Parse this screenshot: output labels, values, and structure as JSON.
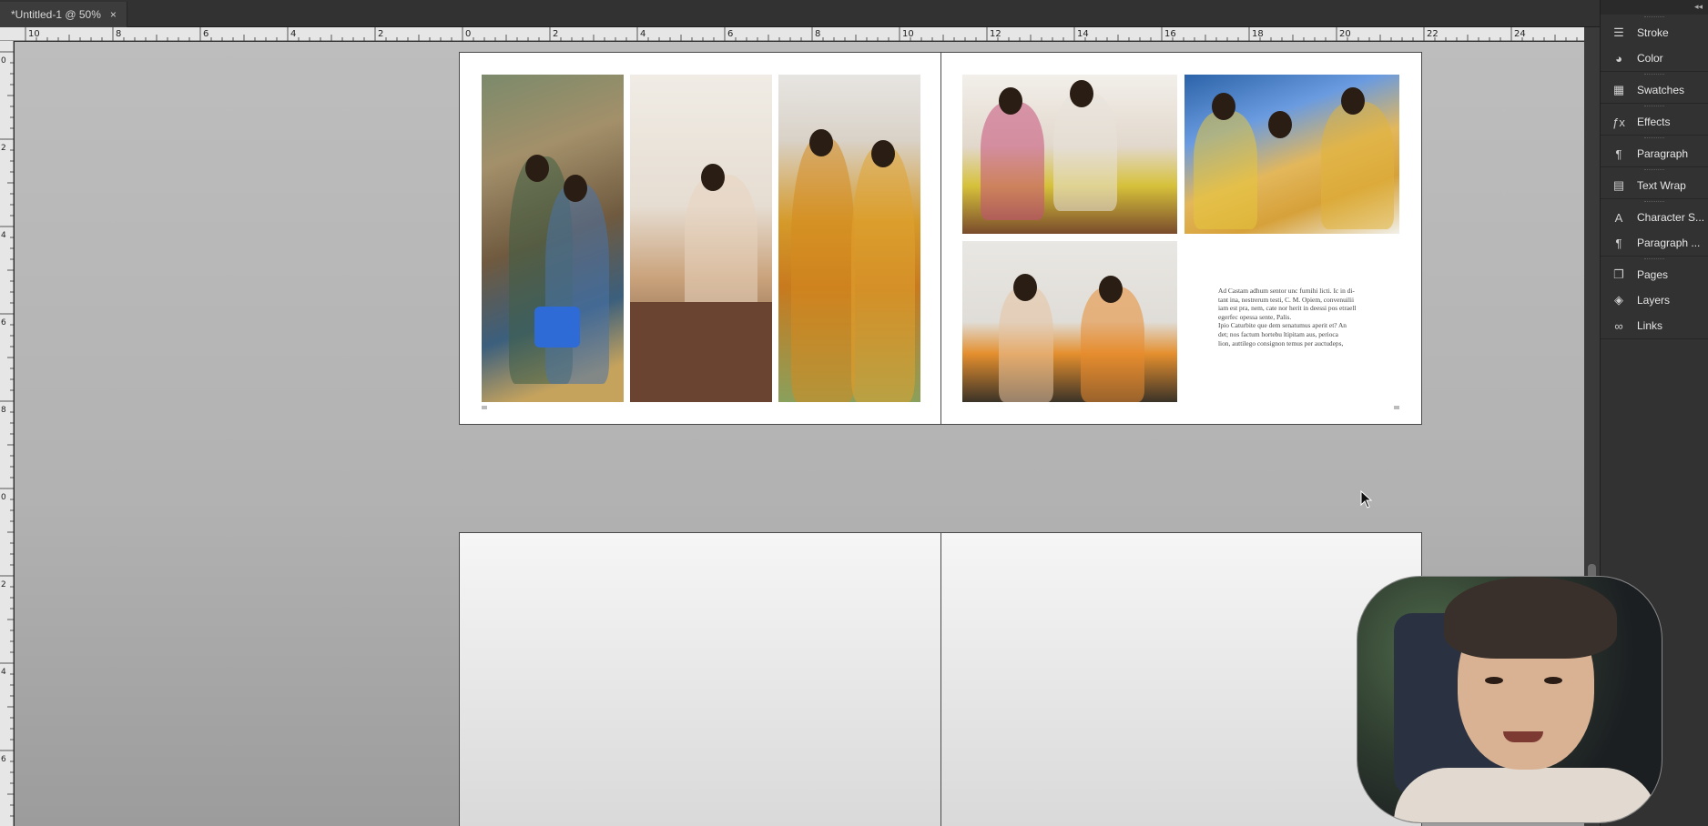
{
  "document": {
    "tab_title": "*Untitled-1 @ 50%",
    "close_glyph": "×"
  },
  "rulers": {
    "horizontal_labels": [
      "10",
      "8",
      "6",
      "4",
      "2",
      "0",
      "2",
      "4",
      "6",
      "8",
      "10",
      "12",
      "14",
      "16",
      "18",
      "20",
      "22",
      "24"
    ],
    "vertical_labels": [
      "0",
      "2",
      "4",
      "6",
      "8",
      "0",
      "2",
      "4",
      "6"
    ]
  },
  "spread": {
    "body_text_lines": [
      "Ad Castam adhum sentor unc furnihi licti. Ic in di-",
      "tant ina, nestrerum testi, C. M. Opiem, convenuilii",
      "iam est pra, nem, cate nor herit in deessi pos etraell",
      "egerfec opessa sente, Palis.",
      "Ipio Caturbite que dem senatumus aperit et? An",
      "det; nos factum hortebu ltipitam aus, perioca",
      "lion, auttilego consignon temus per auctudeps,"
    ]
  },
  "panels": {
    "groups": [
      [
        {
          "label": "Stroke",
          "icon": "stroke-icon"
        },
        {
          "label": "Color",
          "icon": "color-icon"
        }
      ],
      [
        {
          "label": "Swatches",
          "icon": "swatches-icon"
        }
      ],
      [
        {
          "label": "Effects",
          "icon": "effects-icon"
        }
      ],
      [
        {
          "label": "Paragraph",
          "icon": "paragraph-icon"
        }
      ],
      [
        {
          "label": "Text Wrap",
          "icon": "text-wrap-icon"
        }
      ],
      [
        {
          "label": "Character S...",
          "icon": "character-styles-icon"
        },
        {
          "label": "Paragraph ...",
          "icon": "paragraph-styles-icon"
        }
      ],
      [
        {
          "label": "Pages",
          "icon": "pages-icon"
        },
        {
          "label": "Layers",
          "icon": "layers-icon"
        },
        {
          "label": "Links",
          "icon": "links-icon"
        }
      ]
    ]
  },
  "colors": {
    "panel_bg": "#323232",
    "pasteboard": "#b4b4b4",
    "page": "#ffffff",
    "ruler": "#e6e6e6"
  }
}
